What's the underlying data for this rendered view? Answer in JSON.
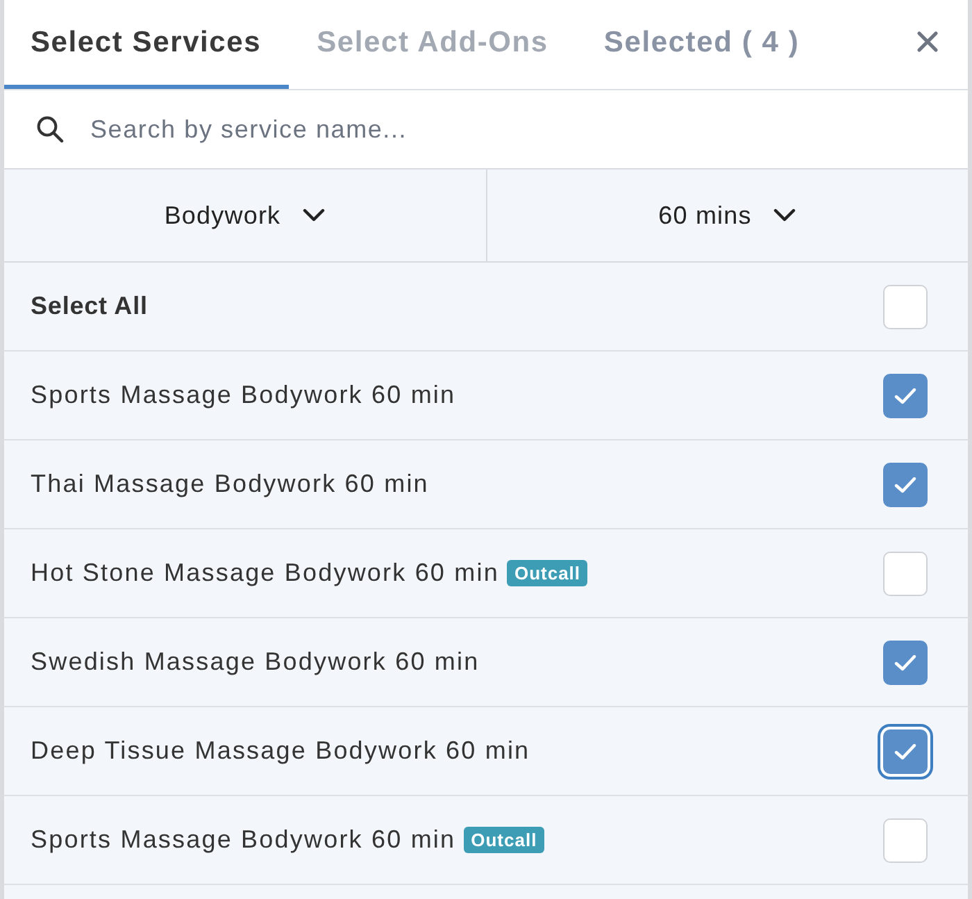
{
  "tabs": [
    {
      "label": "Select Services",
      "selected": true,
      "disabled": false
    },
    {
      "label": "Select Add-Ons",
      "selected": false,
      "disabled": true
    },
    {
      "label": "Selected ( 4 )",
      "selected": false,
      "disabled": false
    }
  ],
  "search": {
    "placeholder": "Search by service name..."
  },
  "filters": [
    {
      "label": "Bodywork"
    },
    {
      "label": "60 mins"
    }
  ],
  "select_all": {
    "label": "Select All",
    "checked": false
  },
  "services": [
    {
      "name": "Sports Massage Bodywork 60 min",
      "checked": true,
      "focused": false
    },
    {
      "name": "Thai Massage Bodywork 60 min",
      "checked": true,
      "focused": false
    },
    {
      "name": "Hot Stone Massage Bodywork 60 min",
      "badge": "Outcall",
      "checked": false,
      "focused": false
    },
    {
      "name": "Swedish Massage Bodywork 60 min",
      "checked": true,
      "focused": false
    },
    {
      "name": "Deep Tissue Massage Bodywork 60 min",
      "checked": true,
      "focused": true
    },
    {
      "name": "Sports Massage Bodywork 60 min",
      "badge": "Outcall",
      "checked": false,
      "focused": false
    }
  ]
}
